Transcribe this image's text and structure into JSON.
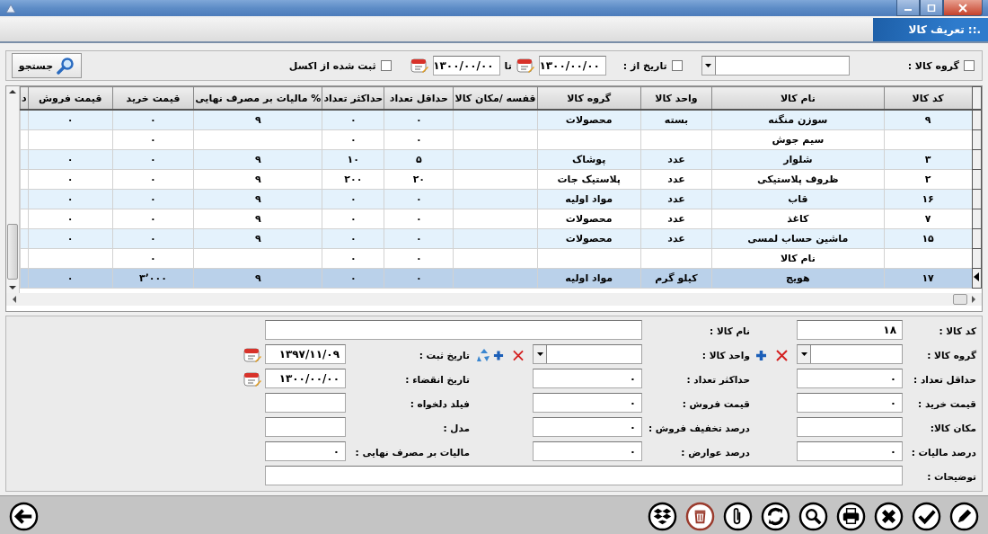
{
  "header": {
    "title": ".:: تعریف کالا"
  },
  "filter": {
    "group": {
      "label": "گروه کالا :",
      "checked": false
    },
    "date": {
      "label": "تاریخ از :",
      "checked": false,
      "from": "۱۳۰۰/۰۰/۰۰",
      "to_label": "تا",
      "to": "۱۳۰۰/۰۰/۰۰"
    },
    "excel": {
      "label": "ثبت شده از اکسل",
      "checked": false
    },
    "search_button": "جستجو"
  },
  "table": {
    "columns": [
      "کد کالا",
      "نام کالا",
      "واحد کالا",
      "گروه کالا",
      "قفسه /مکان کالا",
      "حداقل تعداد",
      "حداکثر تعداد",
      "% مالیات بر مصرف نهایی",
      "قیمت خرید",
      "قیمت فروش",
      "د"
    ],
    "rows": [
      {
        "selected": false,
        "cells": [
          "۹",
          "سوزن منگنه",
          "بسته",
          "محصولات",
          null,
          "۰",
          "۰",
          "۹",
          "۰",
          "۰",
          null
        ]
      },
      {
        "selected": false,
        "cells": [
          null,
          "سیم جوش",
          null,
          null,
          null,
          "۰",
          "۰",
          null,
          "۰",
          null,
          null
        ]
      },
      {
        "selected": false,
        "cells": [
          "۳",
          "شلوار",
          "عدد",
          "پوشاک",
          null,
          "۵",
          "۱۰",
          "۹",
          "۰",
          "۰",
          null
        ]
      },
      {
        "selected": false,
        "cells": [
          "۲",
          "ظروف پلاستیکی",
          "عدد",
          "پلاستیک جات",
          null,
          "۲۰",
          "۲۰۰",
          "۹",
          "۰",
          "۰",
          null
        ]
      },
      {
        "selected": false,
        "cells": [
          "۱۶",
          "قاب",
          "عدد",
          "مواد اولیه",
          null,
          "۰",
          "۰",
          "۹",
          "۰",
          "۰",
          null
        ]
      },
      {
        "selected": false,
        "cells": [
          "۷",
          "کاغذ",
          "عدد",
          "محصولات",
          null,
          "۰",
          "۰",
          "۹",
          "۰",
          "۰",
          null
        ]
      },
      {
        "selected": false,
        "cells": [
          "۱۵",
          "ماشین حساب لمسی",
          "عدد",
          "محصولات",
          null,
          "۰",
          "۰",
          "۹",
          "۰",
          "۰",
          null
        ]
      },
      {
        "selected": false,
        "cells": [
          null,
          "نام کالا",
          null,
          null,
          null,
          "۰",
          "۰",
          null,
          "۰",
          null,
          null
        ]
      },
      {
        "selected": true,
        "cells": [
          "۱۷",
          "هویج",
          "کیلو گرم",
          "مواد اولیه",
          null,
          "۰",
          "۰",
          "۹",
          "۳٬۰۰۰",
          "۰",
          null
        ]
      }
    ]
  },
  "form": {
    "rows": [
      [
        {
          "label": "کد کالا :",
          "kind": "text",
          "value": "۱۸"
        },
        {
          "label": "نام کالا :",
          "kind": "wide"
        }
      ],
      [
        {
          "label": "گروه کالا :",
          "kind": "combo"
        },
        {
          "label": "واحد کالا :",
          "kind": "combo"
        },
        {
          "label": "تاریخ ثبت :",
          "kind": "date",
          "value": "۱۳۹۷/۱۱/۰۹",
          "reset_button": true
        }
      ],
      [
        {
          "label": "حداقل تعداد :",
          "kind": "text",
          "value": "۰"
        },
        {
          "label": "حداکثر تعداد :",
          "kind": "text",
          "value": "۰"
        },
        {
          "label": "تاریخ انقضاء :",
          "kind": "date",
          "value": "۱۳۰۰/۰۰/۰۰",
          "reset_button": false
        }
      ],
      [
        {
          "label": "قیمت خرید :",
          "kind": "text",
          "value": "۰"
        },
        {
          "label": "قیمت فروش :",
          "kind": "text",
          "value": "۰"
        },
        {
          "label": "فیلد دلخواه :",
          "kind": "text"
        }
      ],
      [
        {
          "label": "مکان کالا:",
          "kind": "text"
        },
        {
          "label": "درصد تخفیف فروش :",
          "kind": "text",
          "value": "۰"
        },
        {
          "label": "مدل :",
          "kind": "text"
        }
      ],
      [
        {
          "label": "درصد مالیات :",
          "kind": "text",
          "value": "۰"
        },
        {
          "label": "درصد عوارض :",
          "kind": "text",
          "value": "۰"
        },
        {
          "label": "مالیات بر مصرف نهایی :",
          "kind": "text",
          "value": "۰"
        }
      ],
      [
        {
          "label": "توضیحات :",
          "kind": "wide"
        }
      ]
    ]
  }
}
